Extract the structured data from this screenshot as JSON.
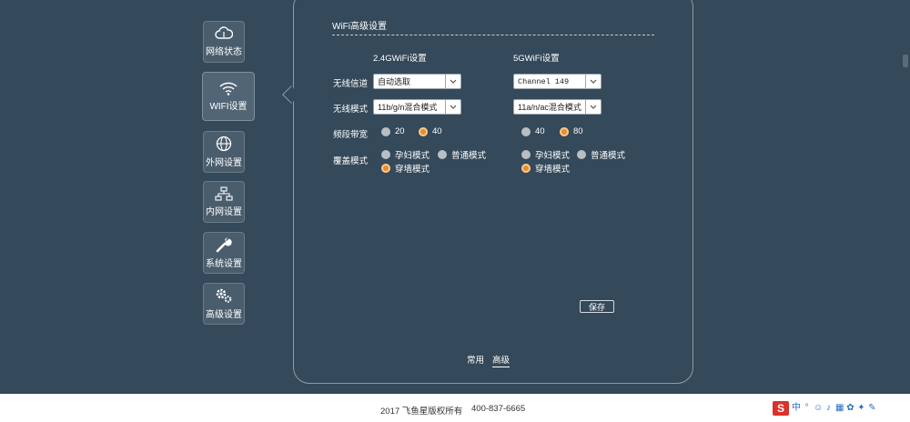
{
  "sidebar": {
    "items": [
      {
        "label": "网络状态",
        "icon": "cloud-icon"
      },
      {
        "label": "WIFI设置",
        "icon": "wifi-icon",
        "active": true
      },
      {
        "label": "外网设置",
        "icon": "globe-icon"
      },
      {
        "label": "内网设置",
        "icon": "network-icon"
      },
      {
        "label": "系统设置",
        "icon": "wrench-icon"
      },
      {
        "label": "高级设置",
        "icon": "gears-icon"
      }
    ]
  },
  "panel": {
    "title": "WiFi高级设置",
    "col_24g": "2.4GWiFi设置",
    "col_5g": "5GWiFi设置",
    "labels": {
      "channel": "无线信道",
      "mode": "无线模式",
      "bandwidth": "频段带宽",
      "coverage": "覆盖模式"
    },
    "g24": {
      "channel": "自动选取",
      "mode": "11b/g/n混合模式",
      "bw_opt1": "20",
      "bw_opt2": "40",
      "bw_selected": "40",
      "cov_opt1": "孕妇模式",
      "cov_opt2": "普通模式",
      "cov_opt3": "穿墙模式",
      "cov_selected": "穿墙模式"
    },
    "g5": {
      "channel": "Channel 149",
      "mode": "11a/n/ac混合模式",
      "bw_opt1": "40",
      "bw_opt2": "80",
      "bw_selected": "80",
      "cov_opt1": "孕妇模式",
      "cov_opt2": "普通模式",
      "cov_opt3": "穿墙模式",
      "cov_selected": "穿墙模式"
    },
    "save_label": "保存",
    "tabs": [
      "常用",
      "高级"
    ],
    "active_tab": "高级"
  },
  "footer": {
    "copyright": "2017 飞鱼星版权所有",
    "phone": "400-837-6665"
  },
  "tray": {
    "logo": "S"
  },
  "colors": {
    "bg": "#34495a",
    "accent": "#e98b2a"
  }
}
